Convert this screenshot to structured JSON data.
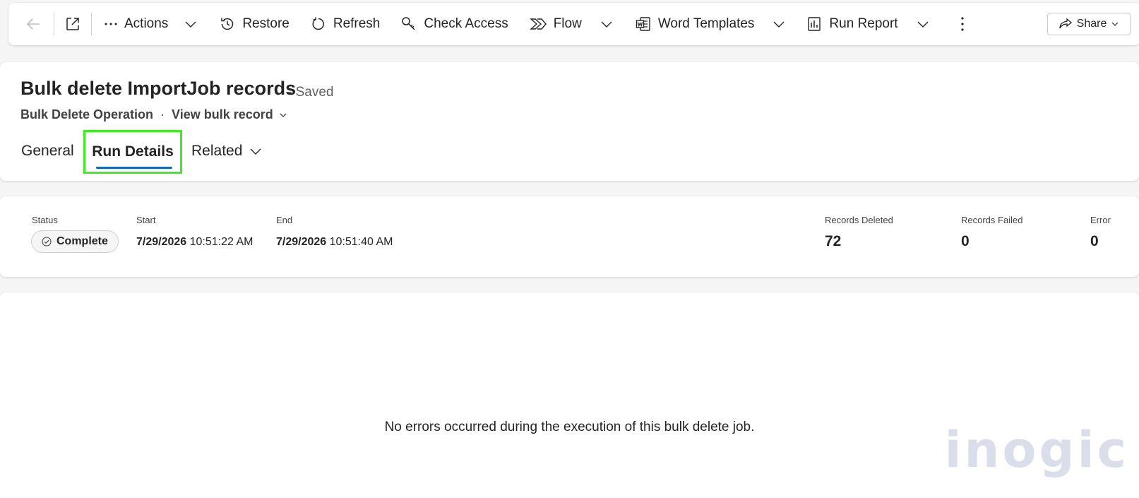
{
  "toolbar": {
    "actions_label": "Actions",
    "restore_label": "Restore",
    "refresh_label": "Refresh",
    "check_access_label": "Check Access",
    "flow_label": "Flow",
    "word_templates_label": "Word Templates",
    "run_report_label": "Run Report",
    "share_label": "Share"
  },
  "header": {
    "title": "Bulk delete ImportJob records",
    "saved_status": "- Saved",
    "entity": "Bulk Delete Operation",
    "separator": "·",
    "view_label": "View bulk record"
  },
  "tabs": [
    {
      "label": "General"
    },
    {
      "label": "Run Details",
      "selected": true
    },
    {
      "label": "Related"
    }
  ],
  "details": {
    "status_label": "Status",
    "status_value": "Complete",
    "start_label": "Start",
    "start_date": "7/29/2026",
    "start_time": "10:51:22 AM",
    "end_label": "End",
    "end_date": "7/29/2026",
    "end_time": "10:51:40 AM",
    "deleted_label": "Records Deleted",
    "deleted_value": "72",
    "failed_label": "Records Failed",
    "failed_value": "0",
    "error_label": "Error",
    "error_value": "0"
  },
  "errors": {
    "message": "No errors occurred during the execution of this bulk delete job."
  },
  "watermark": "inogic",
  "colors": {
    "highlight": "#3bef1f",
    "accent": "#0f6cbd",
    "watermark": "#d9deea"
  }
}
